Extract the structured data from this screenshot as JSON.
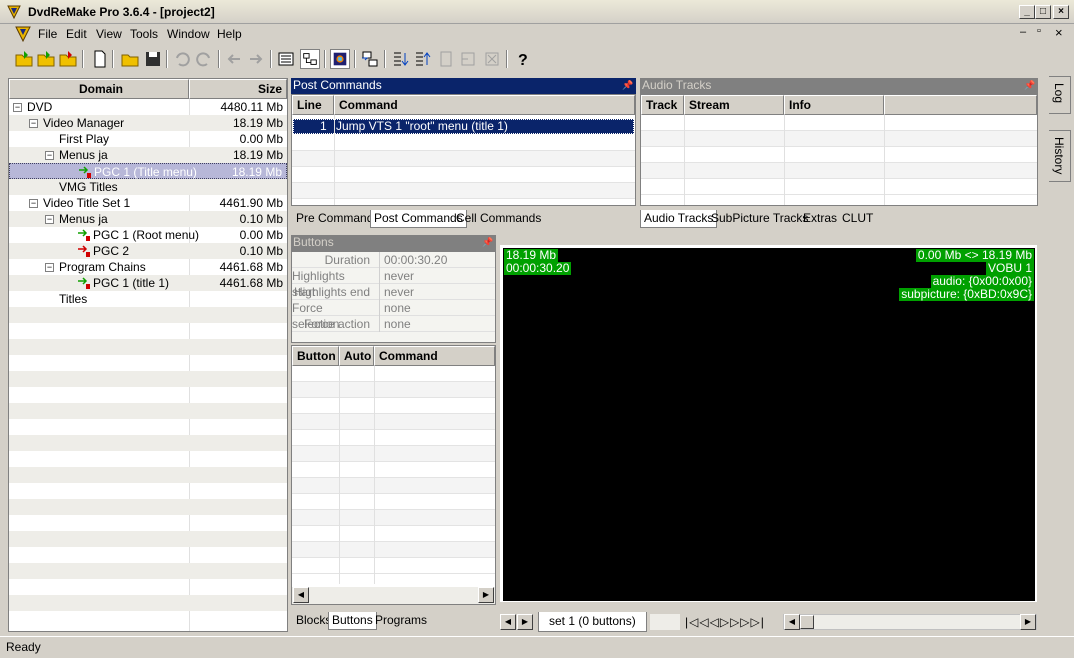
{
  "window": {
    "title": "DvdReMake Pro 3.6.4 - [project2]"
  },
  "menu": [
    {
      "label": "File"
    },
    {
      "label": "Edit"
    },
    {
      "label": "View"
    },
    {
      "label": "Tools"
    },
    {
      "label": "Window"
    },
    {
      "label": "Help"
    }
  ],
  "tree": {
    "headers": {
      "domain": "Domain",
      "size": "Size"
    },
    "rows": [
      {
        "label": "DVD",
        "size": "4480.11 Mb"
      },
      {
        "label": "Video Manager",
        "size": "18.19 Mb"
      },
      {
        "label": "First Play",
        "size": "0.00 Mb"
      },
      {
        "label": "Menus ja",
        "size": "18.19 Mb"
      },
      {
        "label": "PGC 1 (Title menu)",
        "size": "18.19 Mb"
      },
      {
        "label": "VMG Titles",
        "size": ""
      },
      {
        "label": "Video Title Set 1",
        "size": "4461.90 Mb"
      },
      {
        "label": "Menus ja",
        "size": "0.10 Mb"
      },
      {
        "label": "PGC 1 (Root menu)",
        "size": "0.00 Mb"
      },
      {
        "label": "PGC 2",
        "size": "0.10 Mb"
      },
      {
        "label": "Program Chains",
        "size": "4461.68 Mb"
      },
      {
        "label": "PGC 1  (title 1)",
        "size": "4461.68 Mb"
      },
      {
        "label": "Titles",
        "size": ""
      }
    ]
  },
  "post_commands": {
    "title": "Post Commands",
    "headers": {
      "line": "Line",
      "command": "Command"
    },
    "rows": [
      {
        "line": "1",
        "command": "Jump VTS 1 \"root\" menu (title 1)"
      }
    ],
    "tabs": [
      "Pre Commands",
      "Post Commands",
      "Cell Commands"
    ]
  },
  "audio_tracks": {
    "title": "Audio Tracks",
    "headers": {
      "track": "Track",
      "stream": "Stream",
      "info": "Info"
    },
    "tabs": [
      "Audio Tracks",
      "SubPicture Tracks",
      "Extras",
      "CLUT"
    ]
  },
  "buttons_panel": {
    "title": "Buttons",
    "props": [
      {
        "label": "Duration",
        "value": "00:00:30.20"
      },
      {
        "label": "Highlights start",
        "value": "never"
      },
      {
        "label": "Highlights end",
        "value": "never"
      },
      {
        "label": "Force selection",
        "value": "none"
      },
      {
        "label": "Force action",
        "value": "none"
      }
    ],
    "headers": {
      "button": "Button",
      "auto": "Auto",
      "command": "Command"
    },
    "tabs": [
      "Blocks",
      "Buttons",
      "Programs"
    ]
  },
  "preview": {
    "left": [
      "18.19 Mb",
      "00:00:30.20"
    ],
    "right": [
      "0.00 Mb <> 18.19 Mb",
      "VOBU 1",
      "audio: {0x00:0x00}",
      "subpicture: {0xBD:0x9C}"
    ],
    "set_tab": "set 1 (0 buttons)"
  },
  "side_tabs": [
    "Log",
    "History"
  ],
  "status": {
    "text": "Ready"
  },
  "colors": {
    "selection": "#0a246a",
    "treeSelection": "#b7b7d8",
    "overlay": "#00a000"
  }
}
